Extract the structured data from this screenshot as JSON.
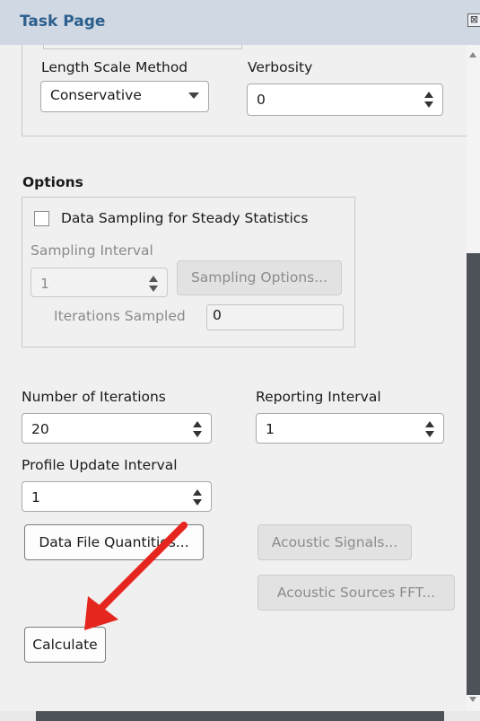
{
  "title": "Task Page",
  "close_glyph": "⊠",
  "length_scale": {
    "label": "Length Scale Method",
    "value": "Conservative"
  },
  "verbosity": {
    "label": "Verbosity",
    "value": "0"
  },
  "options": {
    "heading": "Options",
    "data_sampling": {
      "label": "Data Sampling for Steady Statistics",
      "checked": false
    },
    "sampling_interval": {
      "label": "Sampling Interval",
      "value": "1"
    },
    "sampling_options_button": "Sampling Options...",
    "iterations_sampled": {
      "label": "Iterations Sampled",
      "value": "0"
    }
  },
  "num_iterations": {
    "label": "Number of Iterations",
    "value": "20"
  },
  "reporting_interval": {
    "label": "Reporting Interval",
    "value": "1"
  },
  "profile_update": {
    "label": "Profile Update Interval",
    "value": "1"
  },
  "buttons": {
    "data_file_quantities": "Data File Quantities...",
    "acoustic_signals": "Acoustic Signals...",
    "acoustic_sources_fft": "Acoustic Sources FFT...",
    "calculate": "Calculate"
  },
  "colors": {
    "annotation_arrow": "#e5261f",
    "title_text": "#2c5f8d",
    "scroll_thumb": "#4d5259"
  }
}
